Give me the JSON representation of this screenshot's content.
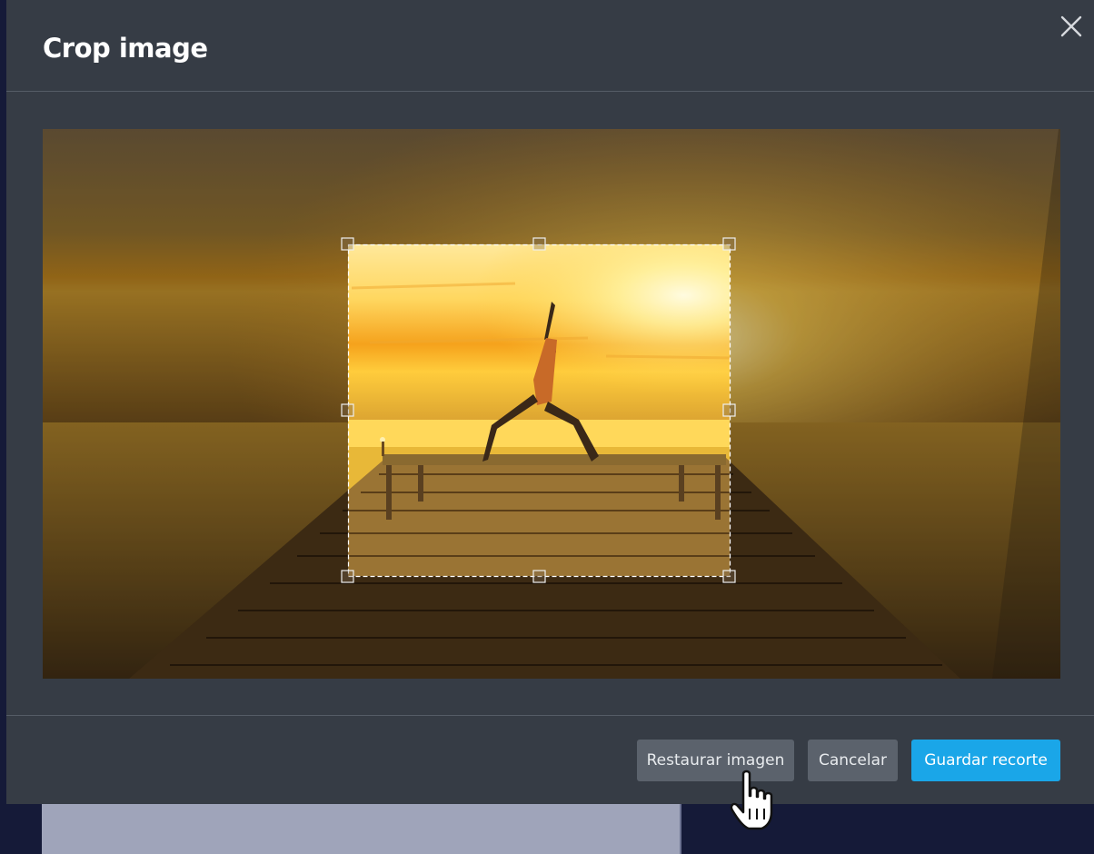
{
  "dialog": {
    "title": "Crop image",
    "close_icon": "close-icon"
  },
  "crop": {
    "image_description_icon": "photo",
    "handles": [
      "top-left",
      "top",
      "top-right",
      "left",
      "right",
      "bottom-left",
      "bottom",
      "bottom-right"
    ]
  },
  "footer": {
    "restore_label": "Restaurar imagen",
    "cancel_label": "Cancelar",
    "save_label": "Guardar recorte"
  },
  "colors": {
    "modal_bg": "#363c45",
    "page_bg": "#151a38",
    "primary": "#1aa6e8",
    "secondary": "#5b626c"
  }
}
